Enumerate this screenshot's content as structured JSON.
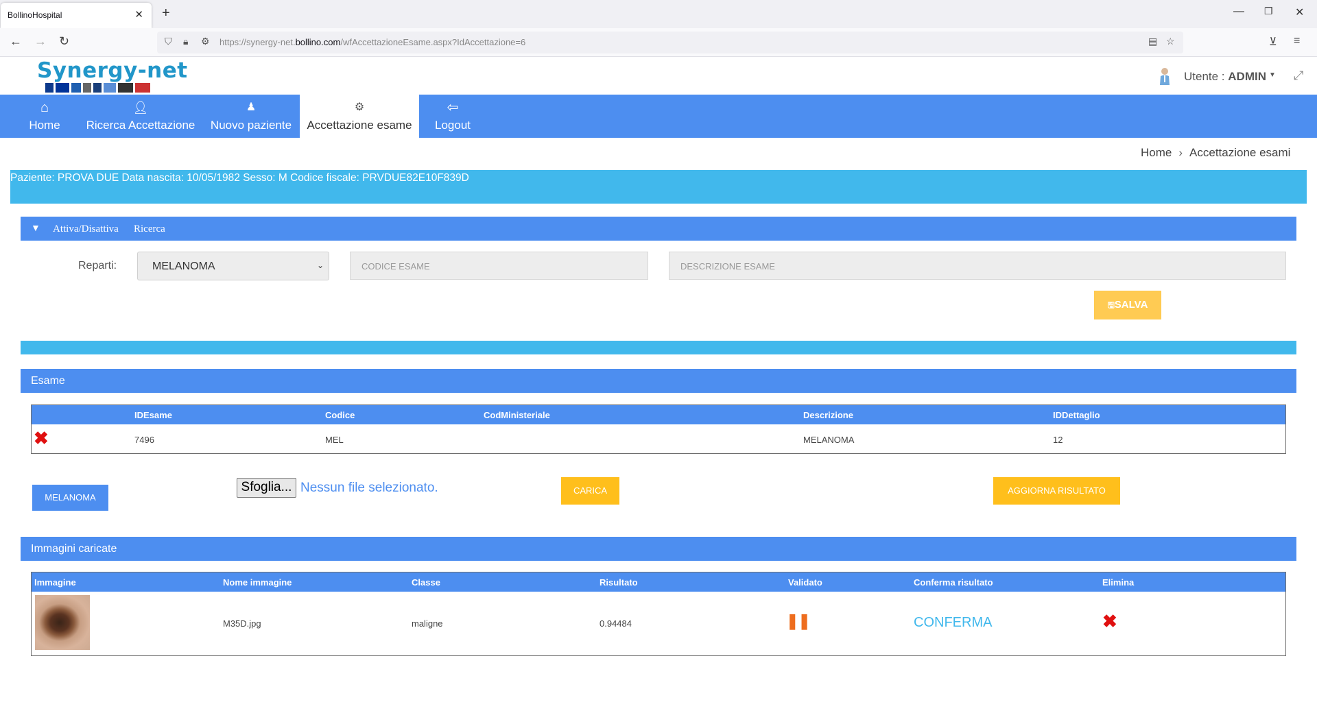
{
  "browser": {
    "tab_title": "BollinoHospital",
    "url_prefix": "https://synergy-net.",
    "url_domain": "bollino.com",
    "url_suffix": "/wfAccettazioneEsame.aspx?IdAccettazione=6"
  },
  "header": {
    "logo_text": "Synergy-net",
    "user_label": "Utente : ",
    "user_name": "ADMIN"
  },
  "menu": {
    "items": [
      {
        "label": "Home",
        "icon": "home-icon"
      },
      {
        "label": "Ricerca Accettazione",
        "icon": "user-add-icon"
      },
      {
        "label": "Nuovo paziente",
        "icon": "user-icon"
      },
      {
        "label": "Accettazione esame",
        "icon": "gear-icon"
      },
      {
        "label": "Logout",
        "icon": "logout-icon"
      }
    ],
    "active": "Accettazione esame"
  },
  "breadcrumb": {
    "home": "Home",
    "current": "Accettazione esami"
  },
  "patient": {
    "text": "Paziente: PROVA DUE  Data nascita: 10/05/1982  Sesso: M  Codice fiscale: PRVDUE82E10F839D"
  },
  "search": {
    "toggle_label": "Attiva/Disattiva",
    "search_label": "Ricerca",
    "reparti_label": "Reparti:",
    "reparti_value": "MELANOMA",
    "codice_placeholder": "CODICE ESAME",
    "descrizione_placeholder": "DESCRIZIONE ESAME",
    "save_label": "SALVA"
  },
  "esame": {
    "title": "Esame",
    "columns": [
      "IDEsame",
      "Codice",
      "CodMinisteriale",
      "Descrizione",
      "IDDettaglio"
    ],
    "rows": [
      {
        "id_esame": "7496",
        "codice": "MEL",
        "cod_ministeriale": "",
        "descrizione": "MELANOMA",
        "id_dettaglio": "12"
      }
    ]
  },
  "upload": {
    "category_button": "MELANOMA",
    "browse_label": "Sfoglia...",
    "no_file": "Nessun file selezionato.",
    "carica_label": "CARICA",
    "aggiorna_label": "AGGIORNA RISULTATO"
  },
  "immagini": {
    "title": "Immagini caricate",
    "columns": [
      "Immagine",
      "Nome immagine",
      "Classe",
      "Risultato",
      "Validato",
      "Conferma risultato",
      "Elimina"
    ],
    "rows": [
      {
        "nome": "M35D.jpg",
        "classe": "maligne",
        "risultato": "0.94484",
        "validato_icon": "pause-icon",
        "conferma": "CONFERMA"
      }
    ]
  },
  "colors": {
    "primary_blue": "#4d8ef0",
    "cyan": "#41b8ec",
    "yellow": "#ffbf1c",
    "delete_red": "#e01010"
  }
}
